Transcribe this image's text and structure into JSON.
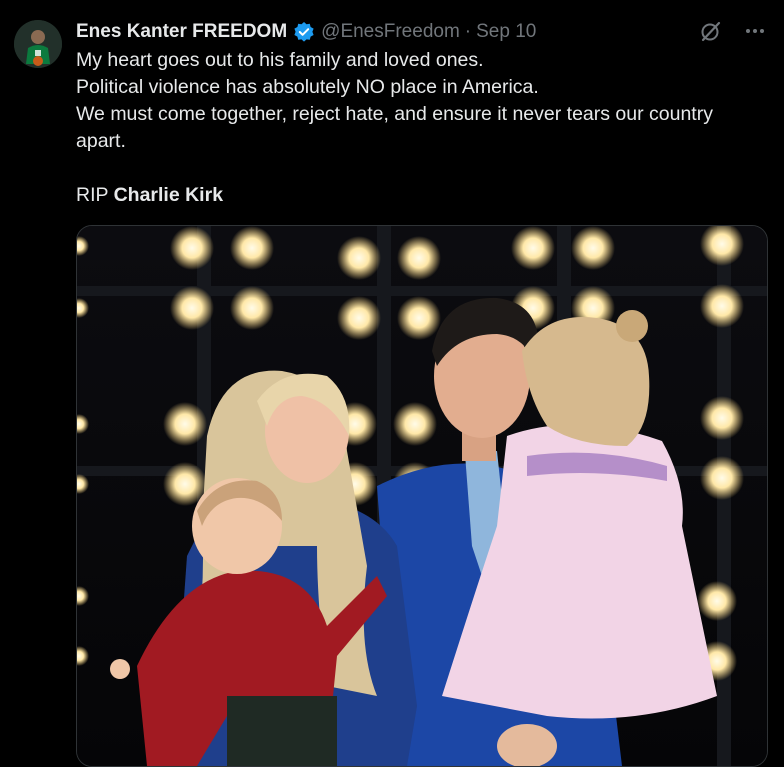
{
  "author": {
    "display_name": "Enes Kanter FREEDOM",
    "handle": "@EnesFreedom",
    "separator": "·",
    "date": "Sep 10",
    "verified": true
  },
  "tweet": {
    "lines": [
      "My heart goes out to his family and loved ones.",
      "Political violence has absolutely NO place in America.",
      "We must come together, reject hate, and ensure it never tears our country apart."
    ],
    "rip_prefix": "RIP ",
    "rip_name": "Charlie Kirk"
  },
  "icons": {
    "verified": "verified-badge-icon",
    "grok": "grok-icon",
    "more": "more-icon"
  },
  "colors": {
    "background": "#000000",
    "text": "#e7e9ea",
    "secondary": "#71767b",
    "verified": "#1d9bf0"
  },
  "media": {
    "type": "photo"
  }
}
